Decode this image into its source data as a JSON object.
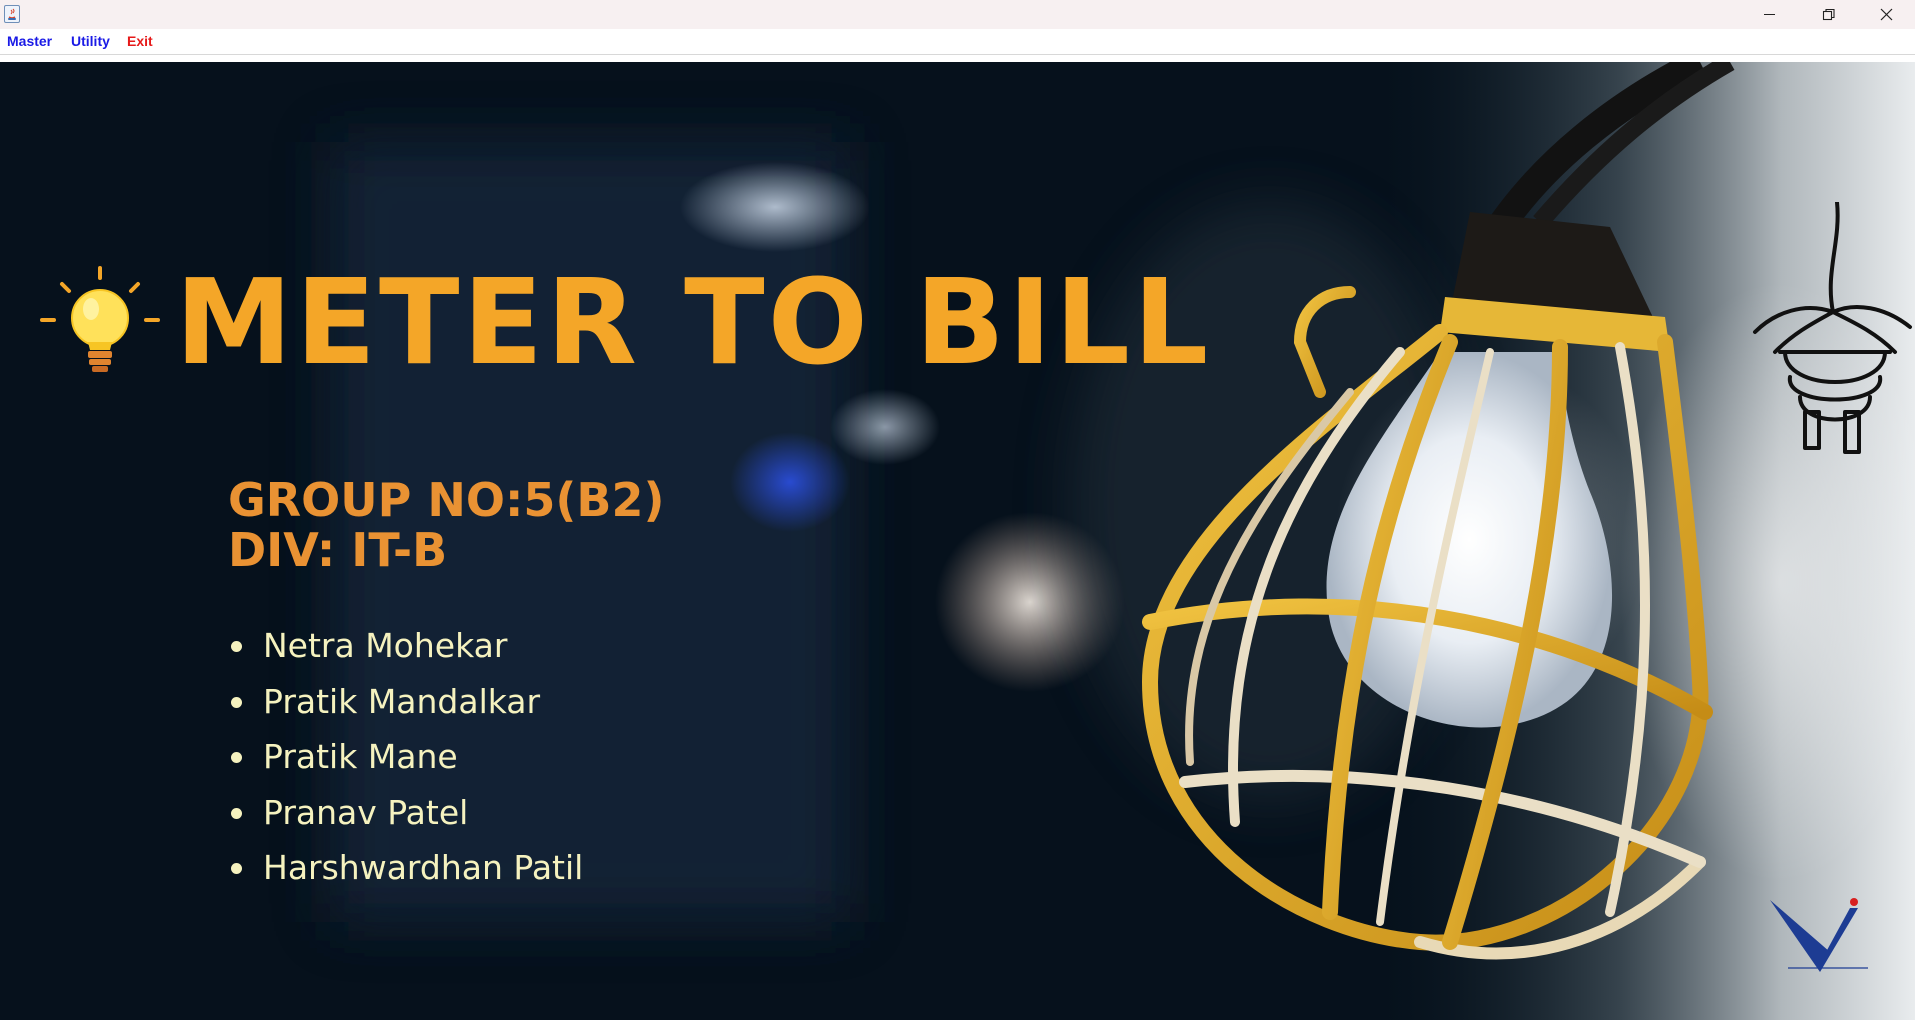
{
  "window": {
    "title": "",
    "controls": {
      "minimize_icon": "minimize-icon",
      "maximize_icon": "restore-icon",
      "close_icon": "close-icon"
    }
  },
  "menubar": {
    "items": [
      {
        "label": "Master",
        "color": "#1a1ae6"
      },
      {
        "label": "Utility",
        "color": "#1a1ae6"
      },
      {
        "label": "Exit",
        "color": "#e61919"
      }
    ]
  },
  "banner": {
    "title": "METER TO BILL",
    "title_color": "#f4a628",
    "group_no": "GROUP NO:5(B2)",
    "division": "DIV: IT-B",
    "heading_color": "#e99233",
    "members": [
      "Netra Mohekar",
      "Pratik Mandalkar",
      "Pratik Mane",
      "Pranav Patel",
      "Harshwardhan Patil"
    ],
    "member_color": "#f5f2bf",
    "icons": [
      "light-bulb-icon",
      "caged-lamp-illustration",
      "plug-icon",
      "vit-logo"
    ]
  }
}
